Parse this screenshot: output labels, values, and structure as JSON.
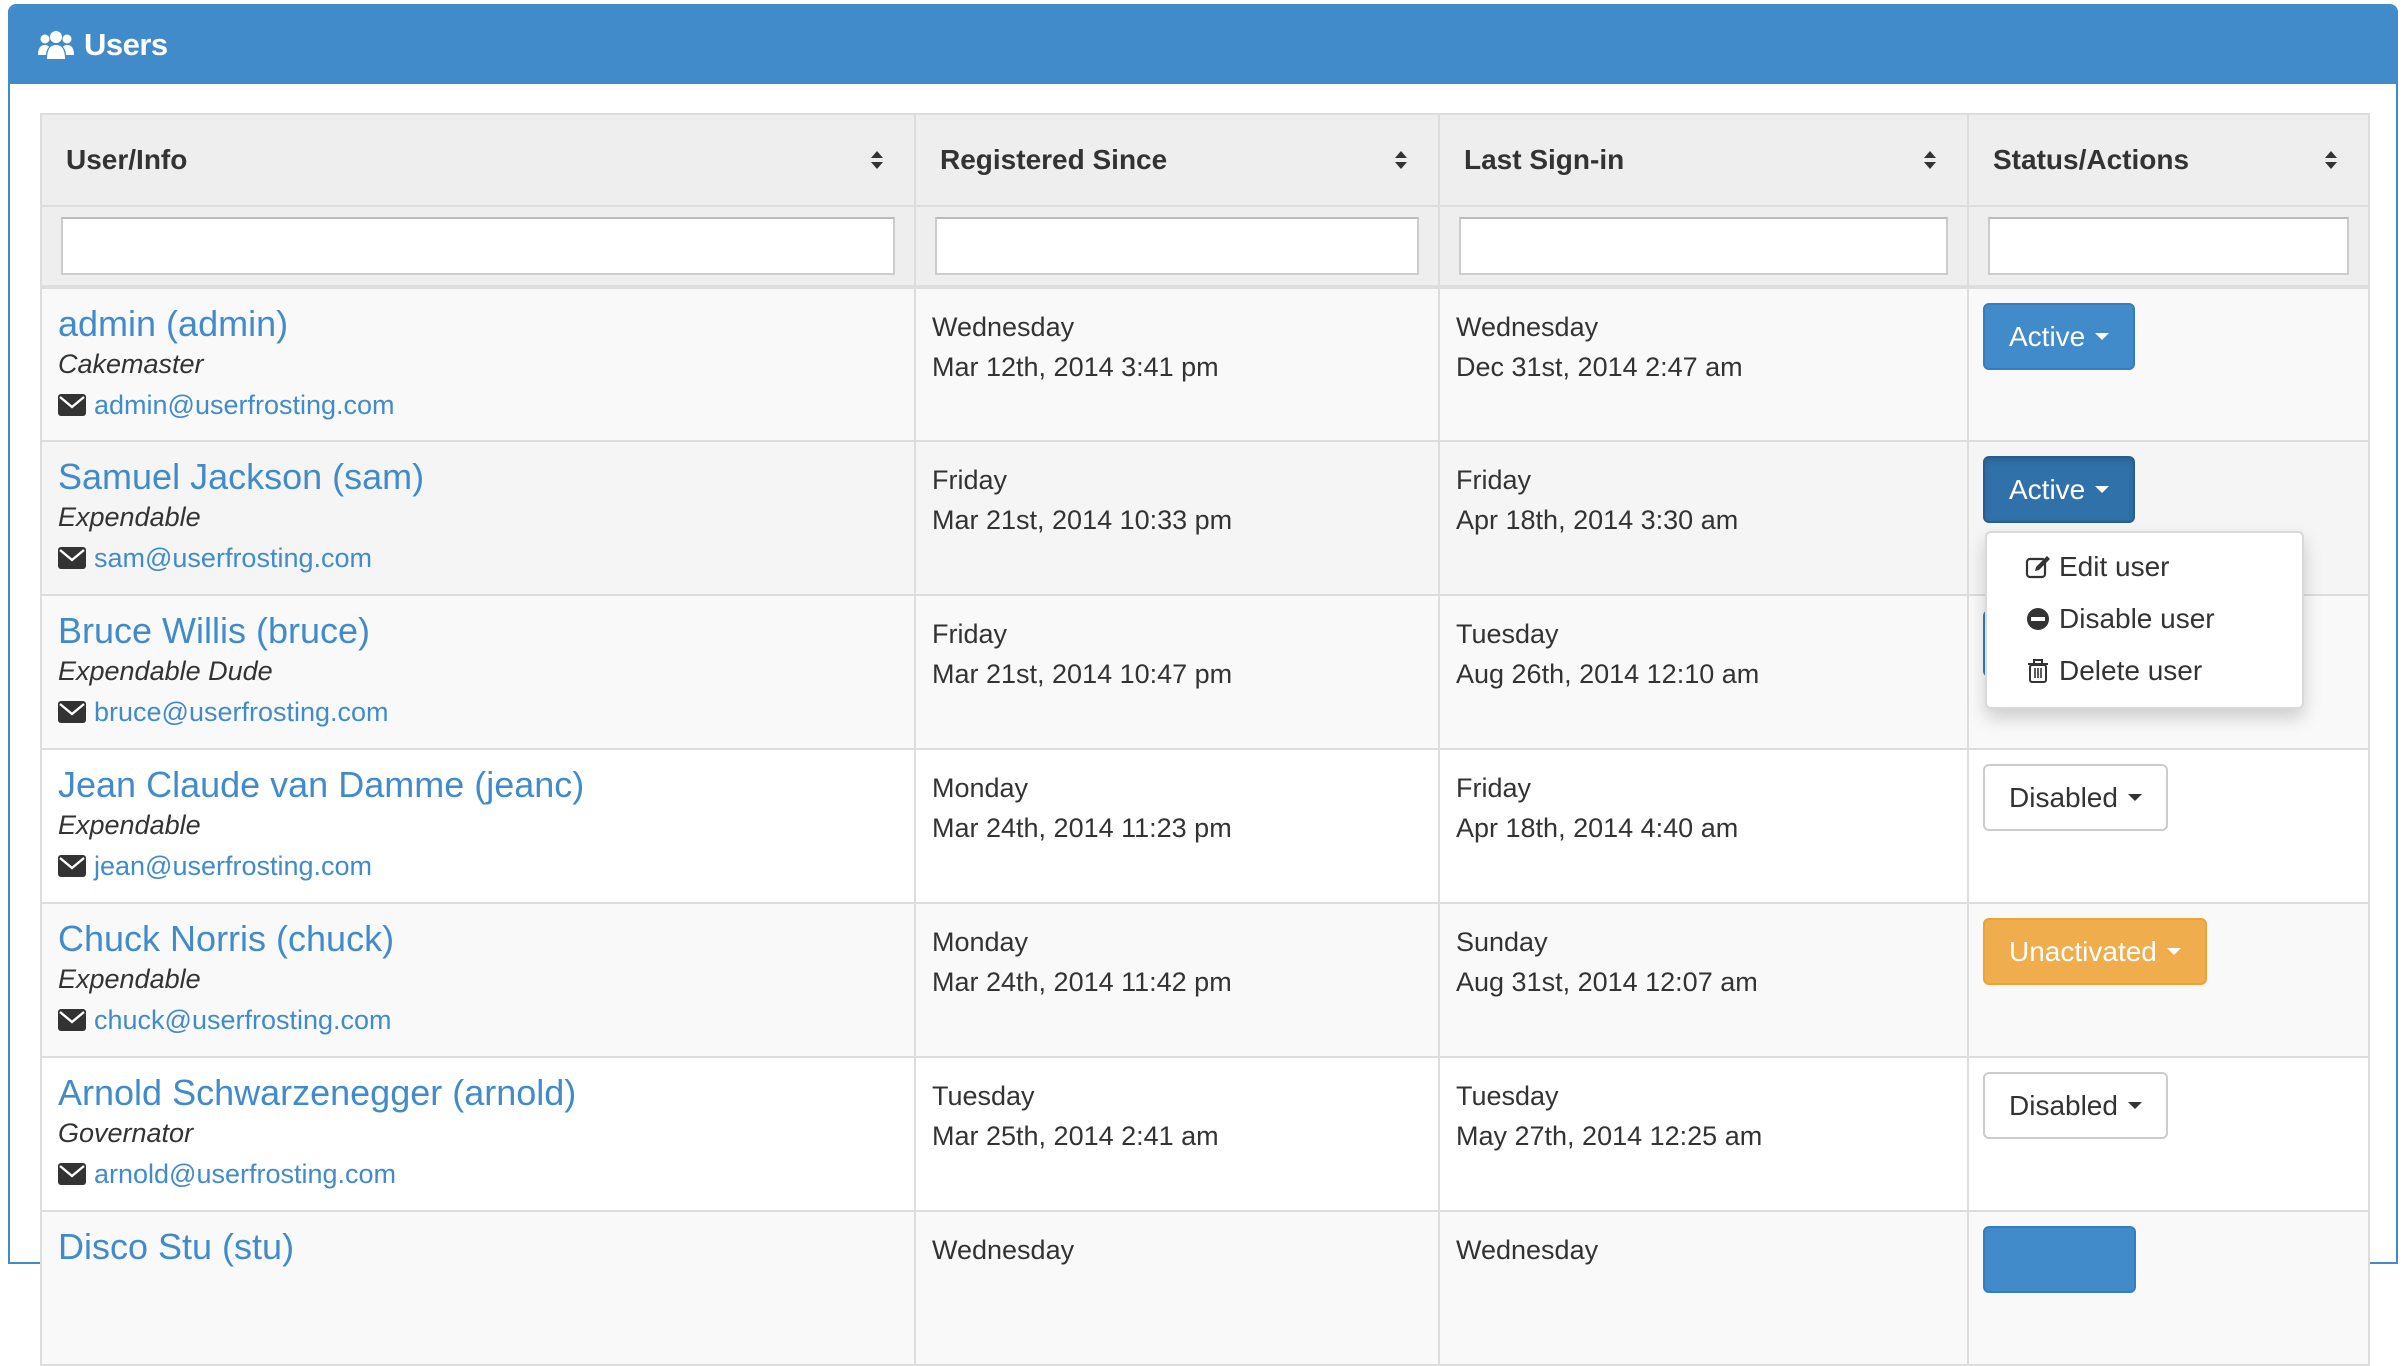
{
  "panel": {
    "title": "Users",
    "icon": "users-icon"
  },
  "table": {
    "columns": [
      {
        "label": "User/Info",
        "sort_icon": "sort-icon",
        "filter_value": ""
      },
      {
        "label": "Registered Since",
        "sort_icon": "sort-icon",
        "filter_value": ""
      },
      {
        "label": "Last Sign-in",
        "sort_icon": "sort-icon",
        "filter_value": ""
      },
      {
        "label": "Status/Actions",
        "sort_icon": "sort-icon",
        "filter_value": ""
      }
    ],
    "rows": [
      {
        "name": "admin (admin)",
        "title": "Cakemaster",
        "email": "admin@userfrosting.com",
        "registered_day": "Wednesday",
        "registered_date": "Mar 12th, 2014 3:41 pm",
        "signin_day": "Wednesday",
        "signin_date": "Dec 31st, 2014 2:47 am",
        "status": "Active",
        "status_color": "#428bca"
      },
      {
        "name": "Samuel Jackson (sam)",
        "title": "Expendable",
        "email": "sam@userfrosting.com",
        "registered_day": "Friday",
        "registered_date": "Mar 21st, 2014 10:33 pm",
        "signin_day": "Friday",
        "signin_date": "Apr 18th, 2014 3:30 am",
        "status": "Active",
        "status_color": "#3071a9"
      },
      {
        "name": "Bruce Willis (bruce)",
        "title": "Expendable Dude",
        "email": "bruce@userfrosting.com",
        "registered_day": "Friday",
        "registered_date": "Mar 21st, 2014 10:47 pm",
        "signin_day": "Tuesday",
        "signin_date": "Aug 26th, 2014 12:10 am",
        "status": "",
        "status_color": "#428bca"
      },
      {
        "name": "Jean Claude van Damme (jeanc)",
        "title": "Expendable",
        "email": "jean@userfrosting.com",
        "registered_day": "Monday",
        "registered_date": "Mar 24th, 2014 11:23 pm",
        "signin_day": "Friday",
        "signin_date": "Apr 18th, 2014 4:40 am",
        "status": "Disabled",
        "status_color": "#ffffff"
      },
      {
        "name": "Chuck Norris (chuck)",
        "title": "Expendable",
        "email": "chuck@userfrosting.com",
        "registered_day": "Monday",
        "registered_date": "Mar 24th, 2014 11:42 pm",
        "signin_day": "Sunday",
        "signin_date": "Aug 31st, 2014 12:07 am",
        "status": "Unactivated",
        "status_color": "#f0ad4e"
      },
      {
        "name": "Arnold Schwarzenegger (arnold)",
        "title": "Governator",
        "email": "arnold@userfrosting.com",
        "registered_day": "Tuesday",
        "registered_date": "Mar 25th, 2014 2:41 am",
        "signin_day": "Tuesday",
        "signin_date": "May 27th, 2014 12:25 am",
        "status": "Disabled",
        "status_color": "#ffffff"
      },
      {
        "name": "Disco Stu (stu)",
        "title": "",
        "email": "",
        "registered_day": "Wednesday",
        "registered_date": "",
        "signin_day": "Wednesday",
        "signin_date": "",
        "status": "",
        "status_color": "#428bca"
      }
    ]
  },
  "dropdown": {
    "open_for_row": 1,
    "items": [
      {
        "label": "Edit user",
        "icon": "edit-icon"
      },
      {
        "label": "Disable user",
        "icon": "minus-circle-icon"
      },
      {
        "label": "Delete user",
        "icon": "trash-icon"
      }
    ]
  }
}
